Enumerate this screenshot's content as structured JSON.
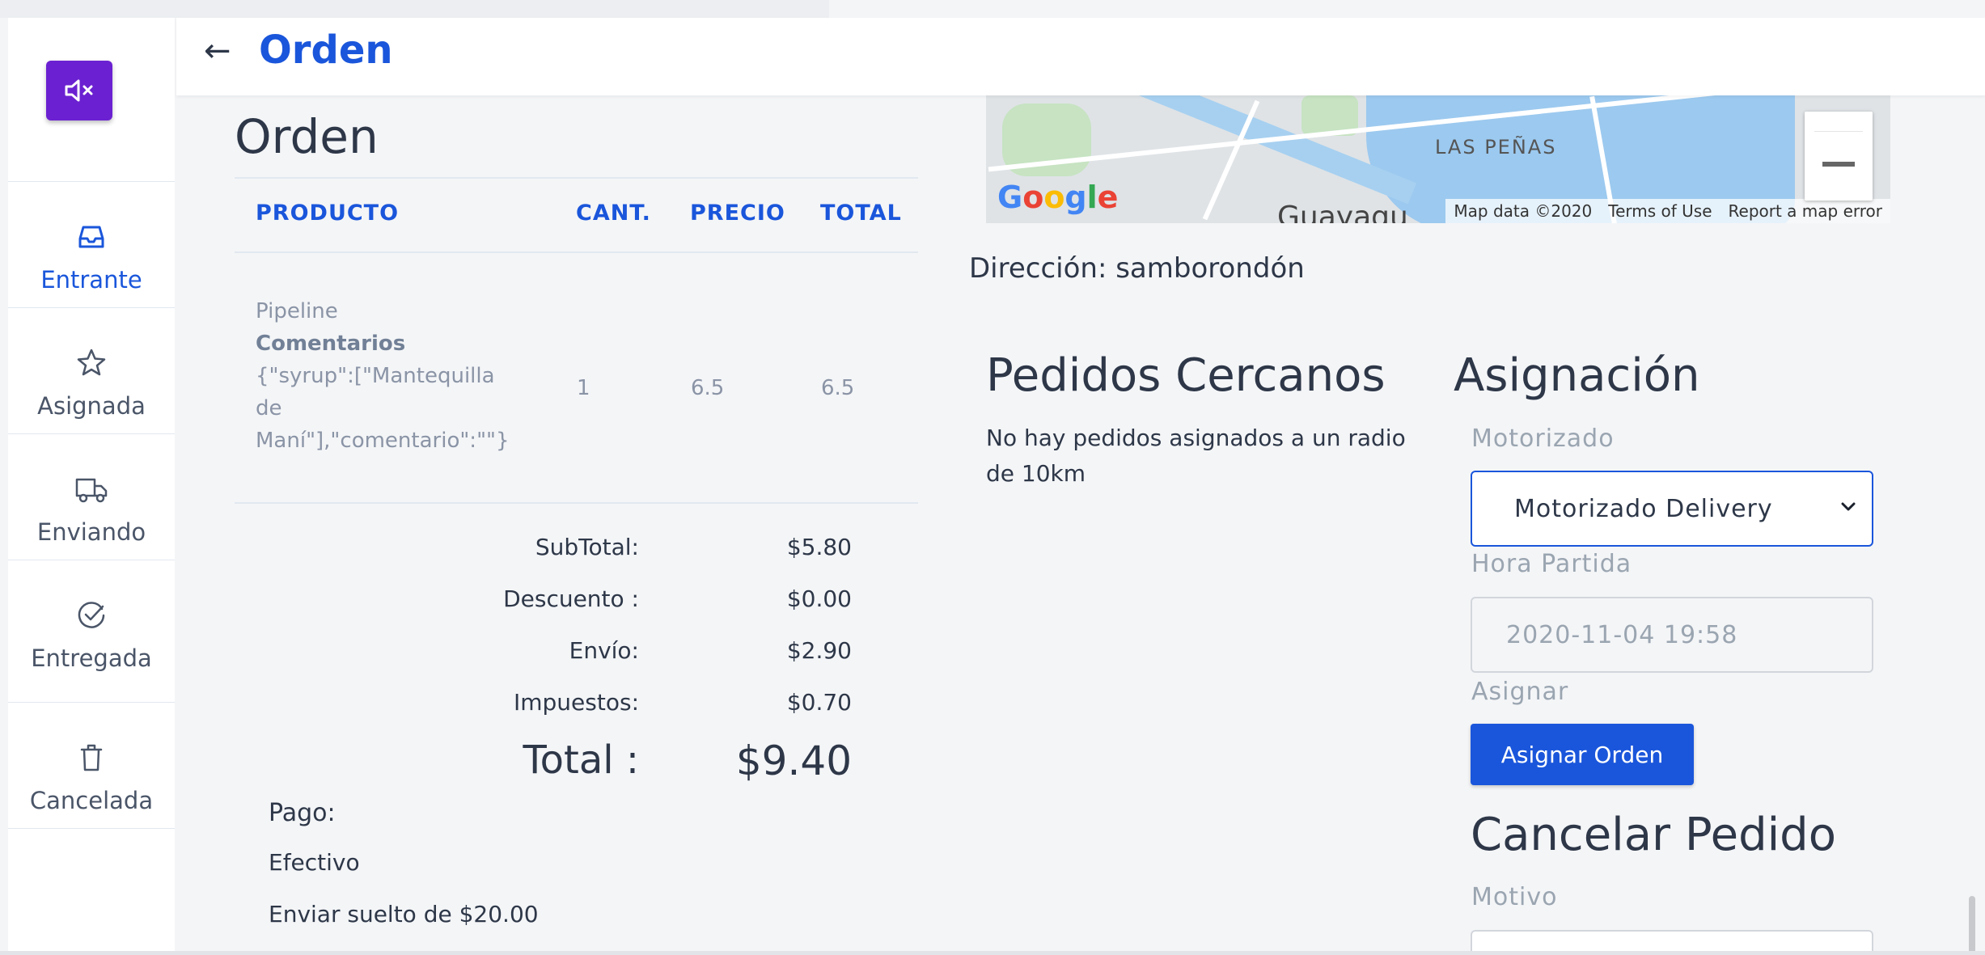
{
  "header": {
    "back_icon": "arrow-left-icon",
    "title": "Orden"
  },
  "sidebar": {
    "mute_icon": "volume-mute-icon",
    "items": [
      {
        "label": "Entrante",
        "icon": "inbox-icon",
        "active": true
      },
      {
        "label": "Asignada",
        "icon": "star-icon",
        "active": false
      },
      {
        "label": "Enviando",
        "icon": "truck-icon",
        "active": false
      },
      {
        "label": "Entregada",
        "icon": "check-circle-icon",
        "active": false
      },
      {
        "label": "Cancelada",
        "icon": "trash-icon",
        "active": false
      }
    ]
  },
  "order": {
    "heading": "Orden",
    "columns": [
      "PRODUCTO",
      "CANT.",
      "PRECIO",
      "TOTAL"
    ],
    "item": {
      "name": "Pipeline",
      "comments_label": "Comentarios",
      "comments_lines": [
        "{\"syrup\":[\"Mantequilla",
        "de",
        "Maní\"],\"comentario\":\"\"}"
      ],
      "qty": "1",
      "price": "6.5",
      "total": "6.5"
    },
    "summary": [
      {
        "label": "SubTotal:",
        "value": "$5.80"
      },
      {
        "label": "Descuento :",
        "value": "$0.00"
      },
      {
        "label": "Envío:",
        "value": "$2.90"
      },
      {
        "label": "Impuestos:",
        "value": "$0.70"
      }
    ],
    "total_label": "Total :",
    "total_value": "$9.40",
    "payment_label": "Pago:",
    "payment_method": "Efectivo",
    "change_note": "Enviar suelto de $20.00"
  },
  "map": {
    "area_label": "LAS PEÑAS",
    "city_label": "Guayaqu",
    "logo": "Google",
    "credits": [
      "Map data ©2020",
      "Terms of Use",
      "Report a map error"
    ],
    "colors": {
      "water": "#9cc9ef",
      "park": "#c7e3c2",
      "land": "#dfe3e6"
    }
  },
  "address": "Dirección: samborondón",
  "nearby": {
    "heading": "Pedidos Cercanos",
    "message": "No hay pedidos asignados a un radio de 10km"
  },
  "assignment": {
    "heading": "Asignación",
    "driver_label": "Motorizado",
    "driver_value": "Motorizado Delivery",
    "departure_label": "Hora Partida",
    "departure_value": "2020-11-04 19:58",
    "assign_label": "Asignar",
    "assign_button": "Asignar Orden"
  },
  "cancel": {
    "heading": "Cancelar Pedido",
    "reason_label": "Motivo"
  },
  "colors": {
    "accent": "#1a56db",
    "mute_button": "#6b21d1"
  }
}
